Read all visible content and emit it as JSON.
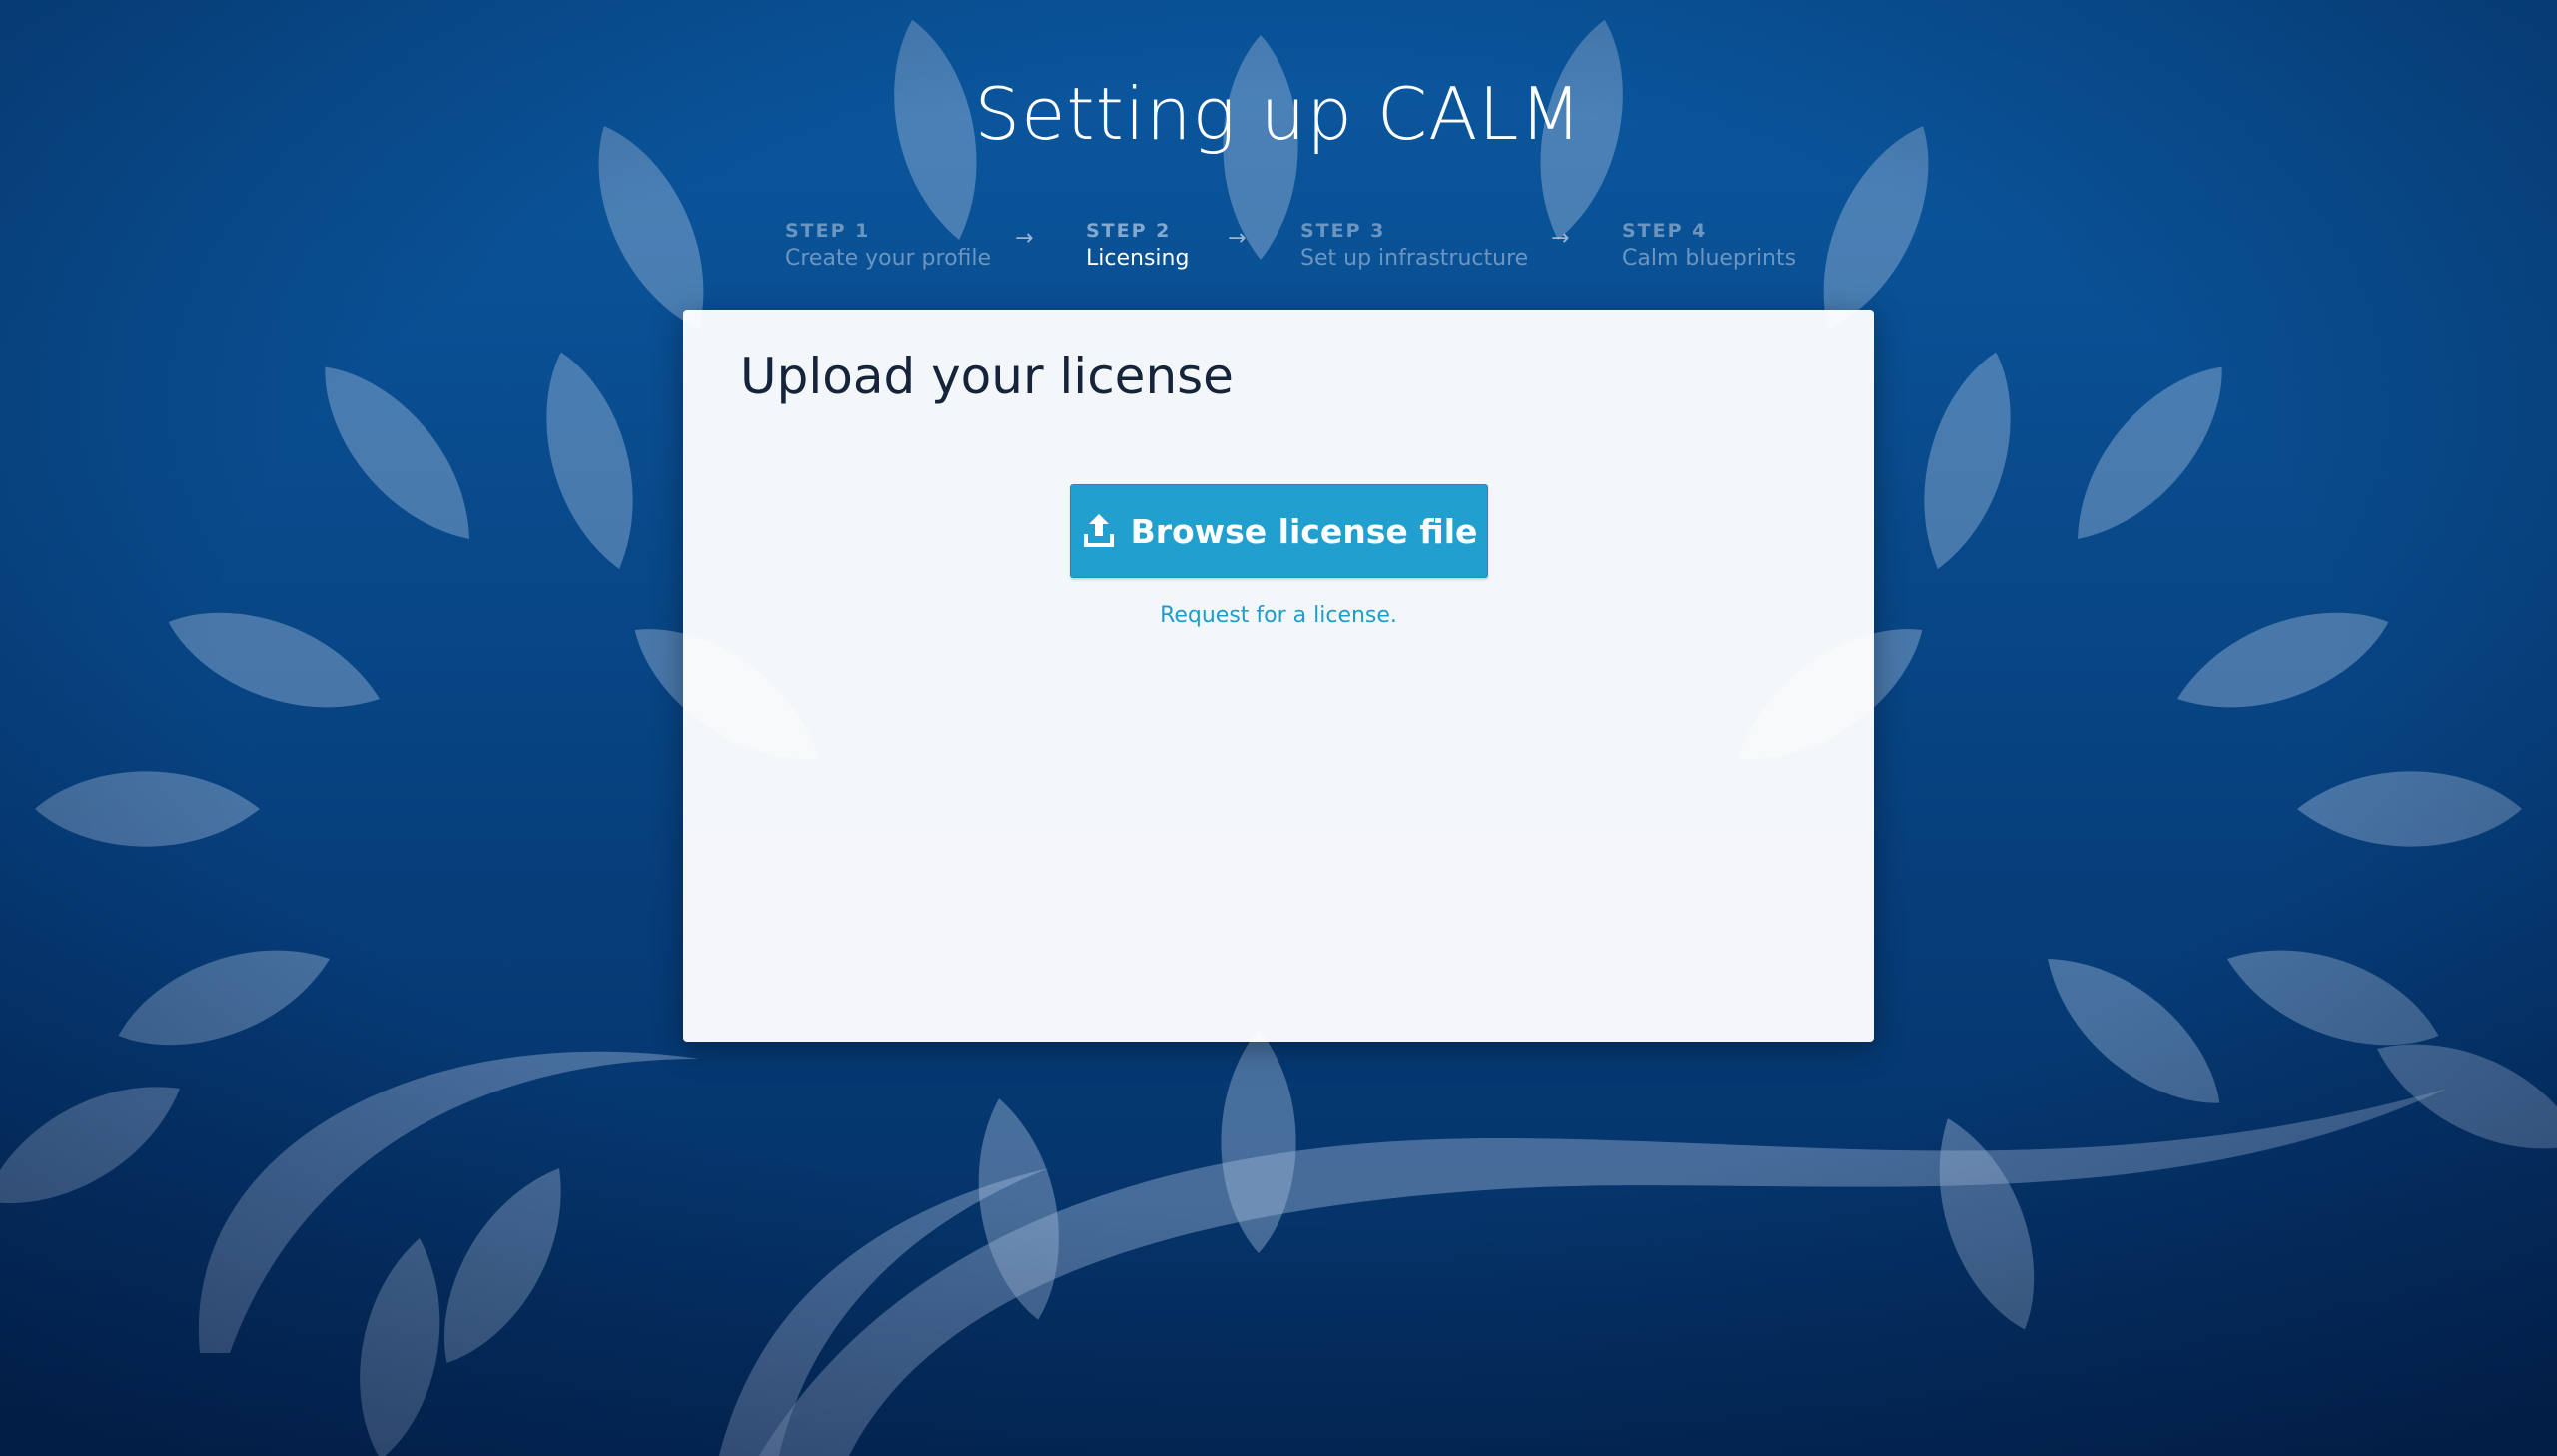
{
  "page": {
    "title": "Setting up CALM"
  },
  "steps": [
    {
      "number": "STEP 1",
      "label": "Create your profile",
      "active": false
    },
    {
      "number": "STEP 2",
      "label": "Licensing",
      "active": true
    },
    {
      "number": "STEP 3",
      "label": "Set up infrastructure",
      "active": false
    },
    {
      "number": "STEP 4",
      "label": "Calm blueprints",
      "active": false
    }
  ],
  "step_separator_icon": "arrow-right-icon",
  "card": {
    "title": "Upload your license",
    "browse_button_label": "Browse license file",
    "browse_button_icon": "upload-icon",
    "request_link": "Request for a license."
  },
  "colors": {
    "background_top": "#0a58a0",
    "background_bottom": "#042d5e",
    "button": "#21a0cf",
    "link": "#1e9ccc",
    "card_title": "#15243a"
  }
}
